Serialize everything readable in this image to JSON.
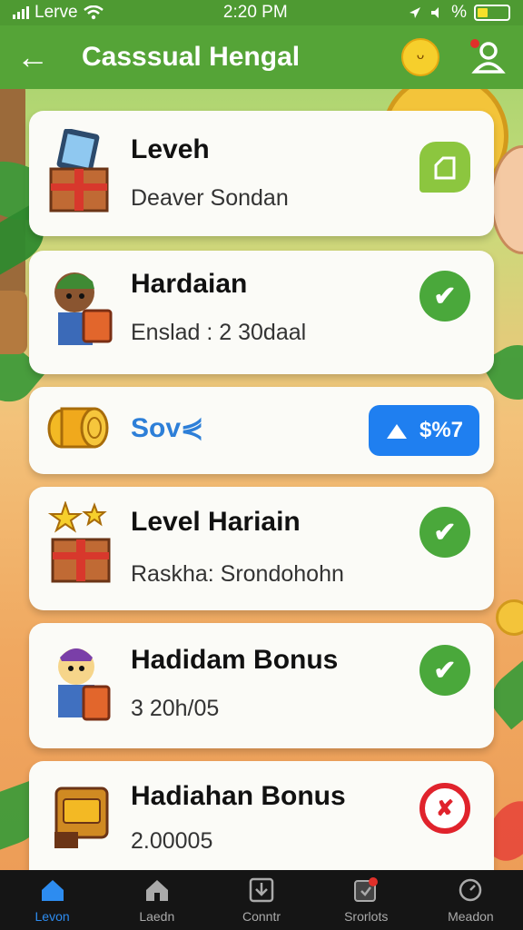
{
  "status_bar": {
    "carrier": "Lerve",
    "time": "2:20 PM",
    "battery_text": "%"
  },
  "header": {
    "title": "Casssual Hengal",
    "back_icon": "back-arrow-icon",
    "emoji_icon": "smiley-icon",
    "profile_icon": "profile-icon"
  },
  "cards": [
    {
      "title": "Leveh",
      "subtitle": "Deaver Sondan",
      "icon": "gift-tablet-icon",
      "action_icon": "tag-icon"
    },
    {
      "title": "Hardaian",
      "subtitle": "Enslad : 2 30daal",
      "icon": "character-box-icon",
      "action_icon": "check-icon"
    },
    {
      "title": "Sov⋞",
      "icon": "coin-rolls-icon",
      "button_label": "$%7",
      "button_icon": "up-arrow-icon"
    },
    {
      "title": "Level Hariain",
      "subtitle": "Raskha: Srondohohn",
      "icon": "gift-stars-icon",
      "action_icon": "check-icon"
    },
    {
      "title": "Hadidam Bonus",
      "subtitle": "3 20h/05",
      "icon": "character-bag-icon",
      "action_icon": "check-icon"
    },
    {
      "title": "Hadiahan Bonus",
      "subtitle": "2.00005",
      "icon": "treasure-chest-icon",
      "action_icon": "denied-icon"
    }
  ],
  "nav": [
    {
      "label": "Levon",
      "icon": "home-icon",
      "active": true
    },
    {
      "label": "Laedn",
      "icon": "home-outline-icon",
      "active": false
    },
    {
      "label": "Conntr",
      "icon": "download-icon",
      "active": false
    },
    {
      "label": "Srorlots",
      "icon": "notification-icon",
      "active": false
    },
    {
      "label": "Meadon",
      "icon": "clock-icon",
      "active": false
    }
  ],
  "colors": {
    "header": "#55a437",
    "check": "#4aa83b",
    "button": "#1f7ff0",
    "active_nav": "#2d8cf0",
    "denied": "#e0232c"
  }
}
